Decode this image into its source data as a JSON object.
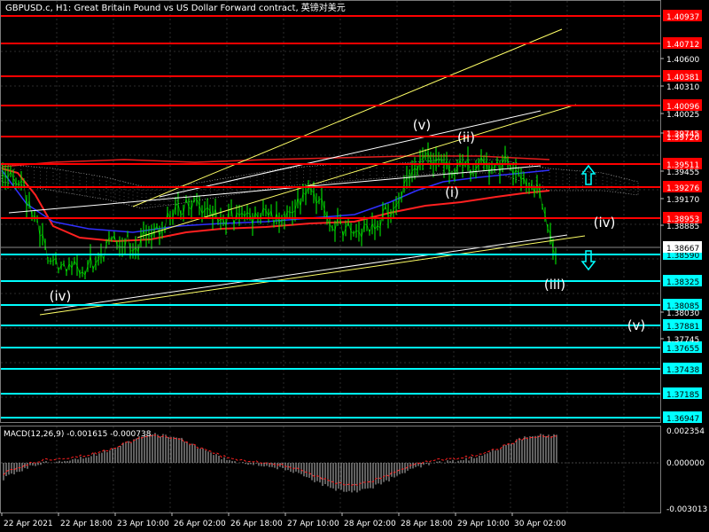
{
  "header": {
    "title": "GBPUSD.c, H1:  Great Britain Pound vs US Dollar Forward contract, 英镑对美元"
  },
  "macd": {
    "title": "MACD(12,26,9) -0.001615 -0.000738",
    "labels": [
      "0.002354",
      "0.000000",
      "-0.003013"
    ]
  },
  "colors": {
    "background": "#000000",
    "grid": "#2b2b2b",
    "candles": "#00ff00",
    "resistance": "#ff0000",
    "support": "#00ffff",
    "trendline_yellow": "#ffff66",
    "trendline_white": "#ffffff",
    "ma_red": "#ff2020",
    "ma_blue": "#3030ff",
    "macd_hist": "#c0c0c0",
    "macd_signal": "#ff2020"
  },
  "price_axis": {
    "red_levels": [
      "1.40937",
      "1.40712",
      "1.40381",
      "1.40096",
      "1.39720",
      "1.39511",
      "1.39276",
      "1.38953"
    ],
    "cyan_levels": [
      "1.38590",
      "1.38325",
      "1.38085",
      "1.37881",
      "1.37655",
      "1.37438",
      "1.37185",
      "1.36947"
    ],
    "plain_labels": [
      "1.40600",
      "1.40310",
      "1.40025",
      "1.39745",
      "1.39455",
      "1.39170",
      "1.38885",
      "1.38030",
      "1.37745"
    ],
    "current_price": "1.38667"
  },
  "time_axis": [
    "22 Apr 2021",
    "22 Apr 18:00",
    "23 Apr 10:00",
    "26 Apr 02:00",
    "26 Apr 18:00",
    "27 Apr 10:00",
    "28 Apr 02:00",
    "28 Apr 18:00",
    "29 Apr 10:00",
    "30 Apr 02:00"
  ],
  "wave_labels": [
    "(v)",
    "(ii)",
    "(i)",
    "(iv)",
    "(iv)",
    "(iii)",
    "(v)"
  ],
  "arrows": [
    "up-arrow-icon",
    "down-arrow-icon"
  ]
}
